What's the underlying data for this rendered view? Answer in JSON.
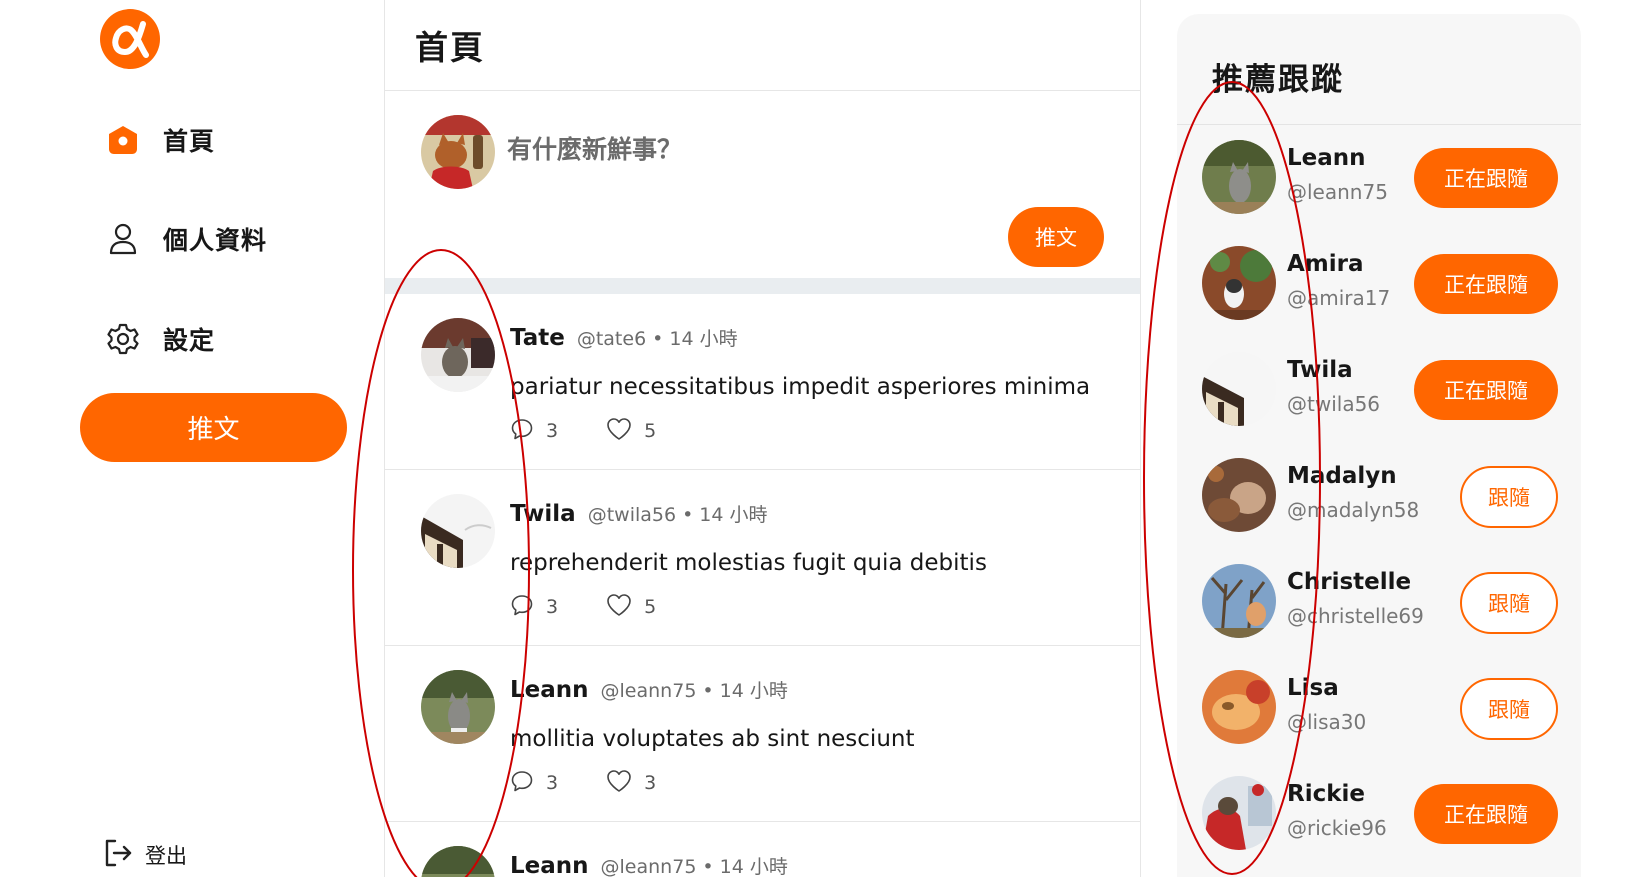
{
  "nav": {
    "home": "首頁",
    "profile": "個人資料",
    "settings": "設定",
    "tweet_button": "推文",
    "logout": "登出"
  },
  "main": {
    "title": "首頁",
    "composer": {
      "placeholder": "有什麼新鮮事？",
      "submit": "推文"
    },
    "tweets": [
      {
        "name": "Tate",
        "handle": "@tate6",
        "dot": "•",
        "time": "14 小時",
        "body": "pariatur necessitatibus impedit asperiores minima",
        "replies": "3",
        "likes": "5"
      },
      {
        "name": "Twila",
        "handle": "@twila56",
        "dot": "•",
        "time": "14 小時",
        "body": "reprehenderit molestias fugit quia debitis",
        "replies": "3",
        "likes": "5"
      },
      {
        "name": "Leann",
        "handle": "@leann75",
        "dot": "•",
        "time": "14 小時",
        "body": "mollitia voluptates ab sint nesciunt",
        "replies": "3",
        "likes": "3"
      },
      {
        "name": "Leann",
        "handle": "@leann75",
        "dot": "•",
        "time": "14 小時"
      }
    ]
  },
  "side": {
    "title": "推薦跟蹤",
    "users": [
      {
        "name": "Leann",
        "handle": "@leann75",
        "button": "正在跟隨"
      },
      {
        "name": "Amira",
        "handle": "@amira17",
        "button": "正在跟隨"
      },
      {
        "name": "Twila",
        "handle": "@twila56",
        "button": "正在跟隨"
      },
      {
        "name": "Madalyn",
        "handle": "@madalyn58",
        "button": "跟隨"
      },
      {
        "name": "Christelle",
        "handle": "@christelle69",
        "button": "跟隨"
      },
      {
        "name": "Lisa",
        "handle": "@lisa30",
        "button": "跟隨"
      },
      {
        "name": "Rickie",
        "handle": "@rickie96",
        "button": "正在跟隨"
      }
    ]
  },
  "colors": {
    "accent": "#ff6600",
    "annotation": "#cc0000",
    "divider": "#e6e6e6"
  },
  "icons": [
    "alpha-logo-icon",
    "home-icon",
    "user-icon",
    "gear-icon",
    "logout-icon",
    "comment-icon",
    "heart-icon"
  ]
}
